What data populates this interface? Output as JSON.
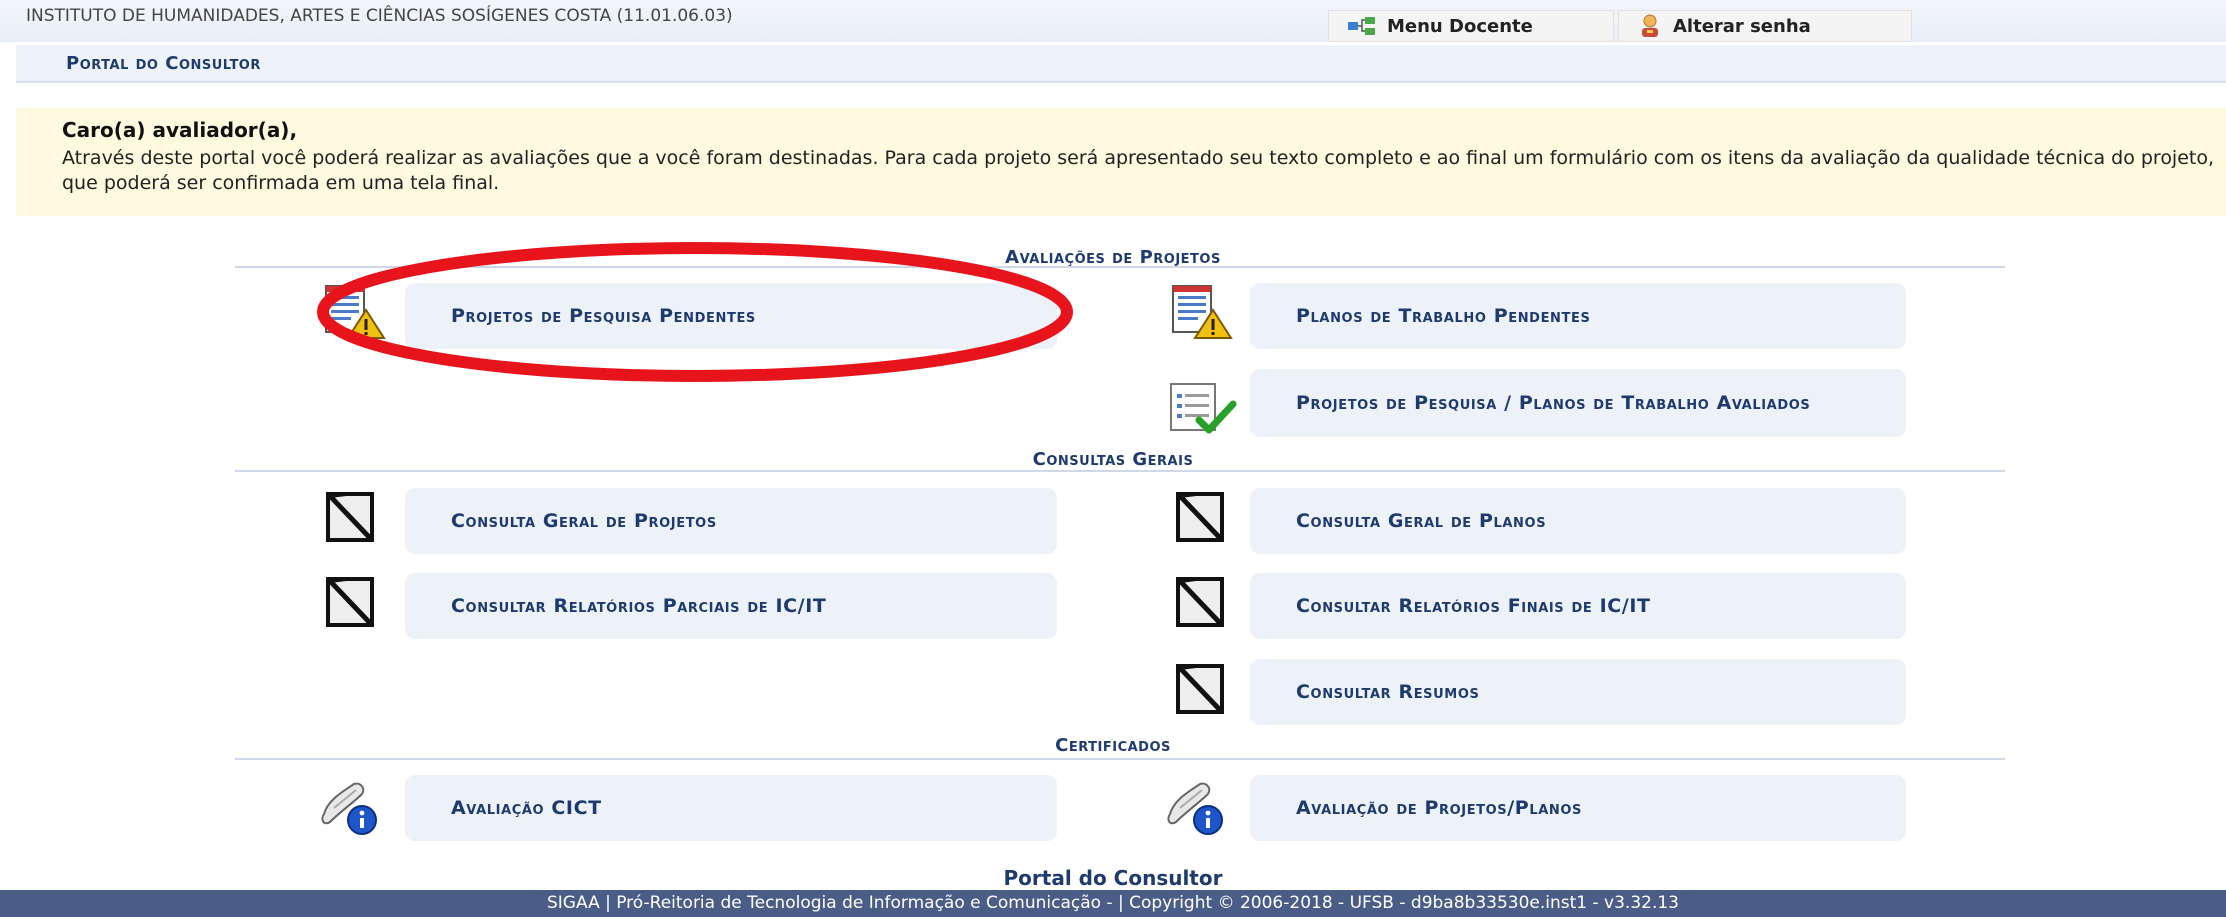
{
  "header": {
    "institution": "INSTITUTO DE HUMANIDADES, ARTES E CIÊNCIAS SOSÍGENES COSTA (11.01.06.03)",
    "menu_docente": "Menu Docente",
    "alterar_senha": "Alterar senha"
  },
  "portal": {
    "title": "Portal do Consultor"
  },
  "notice": {
    "greeting": "Caro(a) avaliador(a),",
    "text": "Através deste portal você poderá realizar as avaliações que a você foram destinadas. Para cada projeto será apresentado seu texto completo e ao final um formulário com os itens da avaliação da qualidade técnica do projeto, que poderá ser confirmada em uma tela final."
  },
  "sections": {
    "avaliacoes": {
      "title": "Avaliações de Projetos",
      "items": [
        "Projetos de Pesquisa Pendentes",
        "Planos de Trabalho Pendentes",
        "Projetos de Pesquisa / Planos de Trabalho Avaliados"
      ]
    },
    "consultas": {
      "title": "Consultas Gerais",
      "items": [
        "Consulta Geral de Projetos",
        "Consulta Geral de Planos",
        "Consultar Relatórios Parciais de IC/IT",
        "Consultar Relatórios Finais de IC/IT",
        "Consultar Resumos"
      ]
    },
    "certificados": {
      "title": "Certificados",
      "items": [
        "Avaliação CICT",
        "Avaliação de Projetos/Planos"
      ]
    }
  },
  "footer": {
    "title": "Portal do Consultor",
    "text": "SIGAA | Pró-Reitoria de Tecnologia de Informação e Comunicação - | Copyright © 2006-2018 - UFSB - d9ba8b33530e.inst1 - v3.32.13"
  },
  "colors": {
    "link": "#1f3a6e",
    "tile": "#edf1f8",
    "notice": "#fdfadf",
    "footer": "#4a5d86",
    "highlight": "#e8141c"
  }
}
